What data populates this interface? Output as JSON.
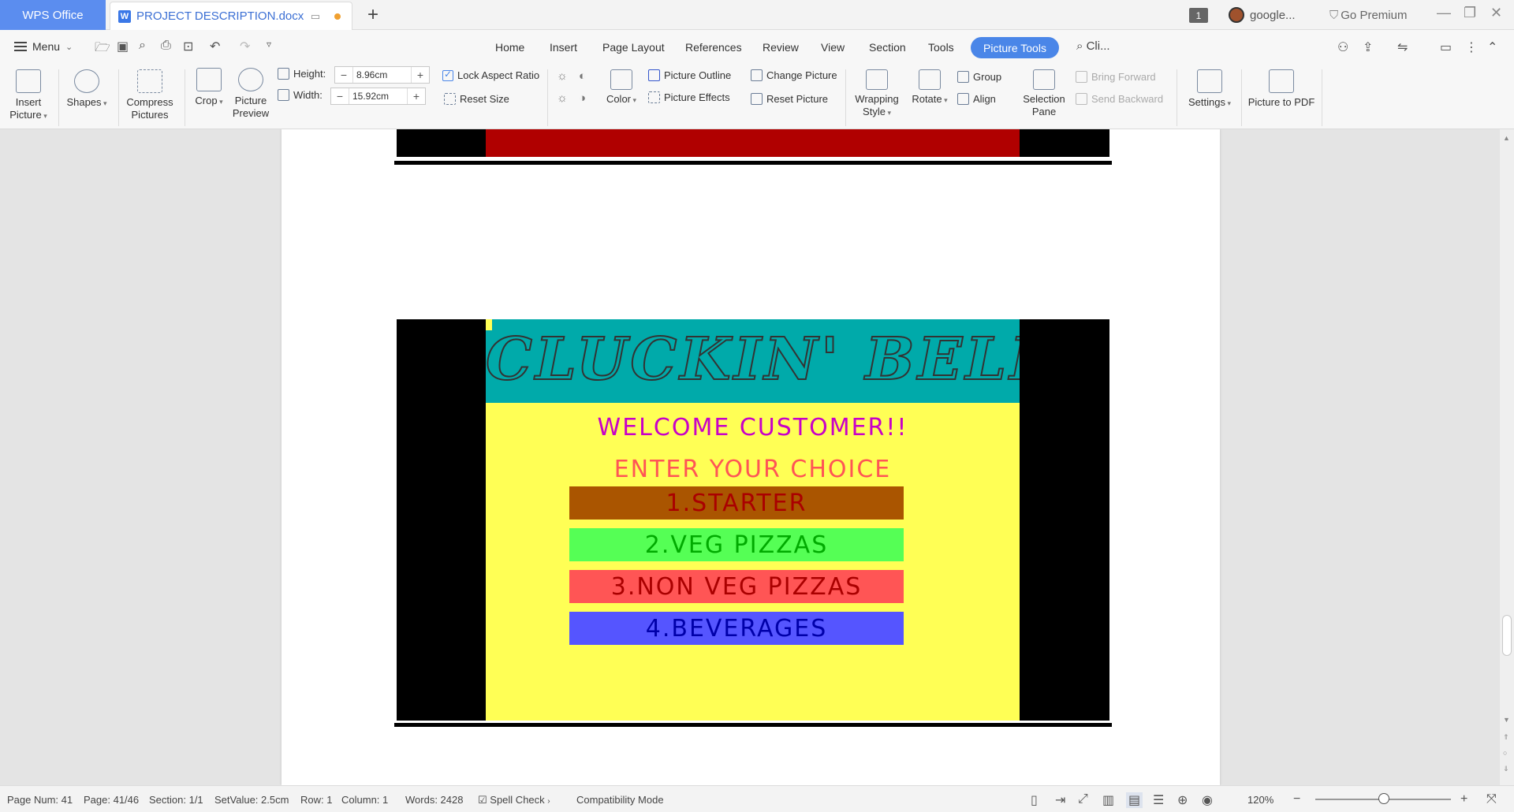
{
  "titlebar": {
    "app_tab": "WPS Office",
    "doc_tab": "PROJECT DESCRIPTION.docx",
    "badge": "1",
    "user": "google...",
    "premium": "Go Premium"
  },
  "menu": {
    "menu_label": "Menu",
    "tabs": [
      "Home",
      "Insert",
      "Page Layout",
      "References",
      "Review",
      "View",
      "Section",
      "Tools"
    ],
    "active_tab": "Picture Tools",
    "search": "Cli..."
  },
  "ribbon": {
    "insert_picture": "Insert Picture",
    "shapes": "Shapes",
    "compress_pictures": "Compress Pictures",
    "crop": "Crop",
    "picture_preview": "Picture Preview",
    "height_label": "Height:",
    "height_value": "8.96cm",
    "width_label": "Width:",
    "width_value": "15.92cm",
    "lock_aspect": "Lock Aspect Ratio",
    "reset_size": "Reset Size",
    "color": "Color",
    "picture_outline": "Picture Outline",
    "picture_effects": "Picture Effects",
    "change_picture": "Change Picture",
    "reset_picture": "Reset Picture",
    "wrapping_style": "Wrapping Style",
    "rotate": "Rotate",
    "group": "Group",
    "align": "Align",
    "selection_pane": "Selection Pane",
    "bring_forward": "Bring Forward",
    "send_backward": "Send Backward",
    "settings": "Settings",
    "picture_to_pdf": "Picture to PDF"
  },
  "game": {
    "title": "CLUCKIN' BELL",
    "welcome": "WELCOME CUSTOMER!!",
    "prompt": "ENTER YOUR CHOICE",
    "options": [
      "1.STARTER",
      "2.VEG PIZZAS",
      "3.NON VEG PIZZAS",
      "4.BEVERAGES"
    ],
    "colors": {
      "header_bg": "#00aaaa",
      "screen_bg": "#ffff55",
      "welcome": "#c800c8",
      "prompt": "#ff5555",
      "opt1_bg": "#aa5500",
      "opt1_fg": "#aa0000",
      "opt2_bg": "#55ff55",
      "opt2_fg": "#00aa00",
      "opt3_bg": "#ff5555",
      "opt3_fg": "#aa0000",
      "opt4_bg": "#5555ff",
      "opt4_fg": "#0000aa"
    }
  },
  "status": {
    "page_num": "Page Num: 41",
    "page": "Page: 41/46",
    "section": "Section: 1/1",
    "set_value": "SetValue: 2.5cm",
    "row": "Row: 1",
    "column": "Column: 1",
    "words": "Words: 2428",
    "spell_check": "Spell Check",
    "compat": "Compatibility Mode",
    "zoom": "120%"
  }
}
